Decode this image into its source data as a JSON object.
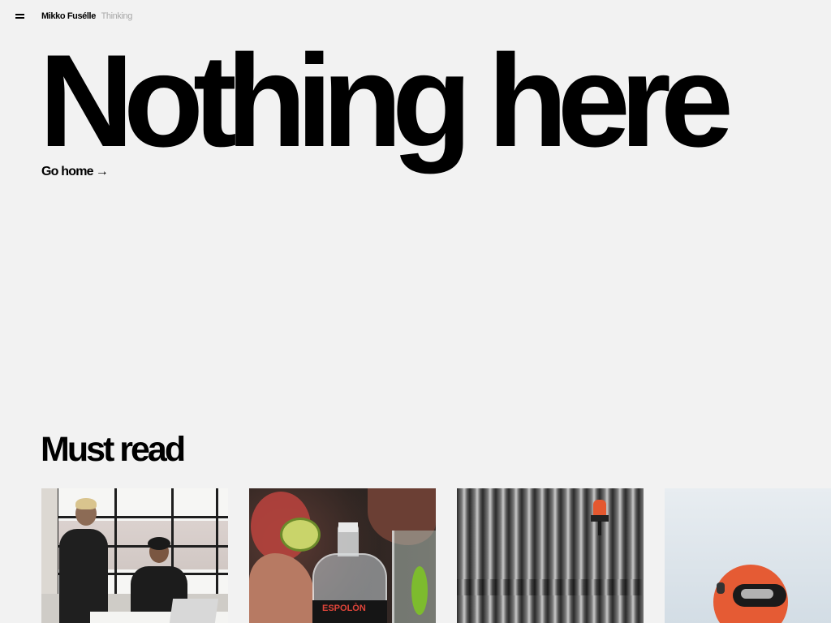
{
  "header": {
    "menu_icon": "hamburger-menu-icon",
    "brand_name": "Mikko Fusélle",
    "section_name": "Thinking"
  },
  "hero": {
    "title": "Nothing here",
    "link_label": "Go home",
    "link_arrow": "→"
  },
  "must_read": {
    "title": "Must read",
    "cards": [
      {
        "image": "office-meeting-photo"
      },
      {
        "image": "tequila-cocktail-photo",
        "label_text": "ESPOLÒN"
      },
      {
        "image": "corrugated-wall-siren-photo"
      },
      {
        "image": "orange-helmet-photo"
      }
    ]
  },
  "colors": {
    "background": "#f2f2f2",
    "text": "#000000",
    "muted_text": "#a8a8a8"
  }
}
